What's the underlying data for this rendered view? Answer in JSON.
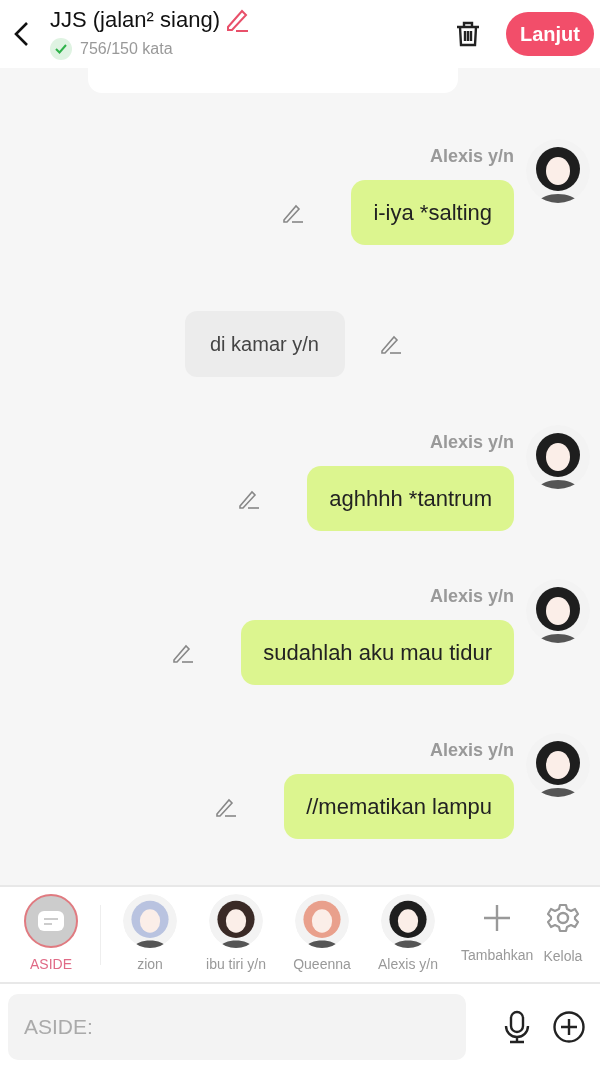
{
  "header": {
    "title": "JJS (jalan² siang)",
    "word_count": "756/150 kata",
    "count_ok": true,
    "next_button": "Lanjut"
  },
  "messages": [
    {
      "kind": "cut"
    },
    {
      "kind": "sent",
      "sender": "Alexis y/n",
      "text": "i-iya *salting"
    },
    {
      "kind": "narration",
      "text": "di kamar y/n"
    },
    {
      "kind": "sent",
      "sender": "Alexis y/n",
      "text": "aghhhh *tantrum"
    },
    {
      "kind": "sent",
      "sender": "Alexis y/n",
      "text": "sudahlah aku mau tidur"
    },
    {
      "kind": "sent",
      "sender": "Alexis y/n",
      "text": "//mematikan lampu"
    }
  ],
  "characters": [
    {
      "kind": "aside",
      "label": "ASIDE",
      "selected": true
    },
    {
      "kind": "character",
      "label": "zion",
      "selected": false,
      "color": "#b9c3e0"
    },
    {
      "kind": "character",
      "label": "ibu tiri y/n",
      "selected": false,
      "color": "#3a2a26"
    },
    {
      "kind": "character",
      "label": "Queenna",
      "selected": false,
      "color": "#e9a08c"
    },
    {
      "kind": "character",
      "label": "Alexis y/n",
      "selected": false,
      "color": "#1e1e1e"
    }
  ],
  "actions": [
    {
      "kind": "add",
      "label": "Tambahkan"
    },
    {
      "kind": "manage",
      "label": "Kelola"
    }
  ],
  "input": {
    "placeholder": "ASIDE:"
  }
}
